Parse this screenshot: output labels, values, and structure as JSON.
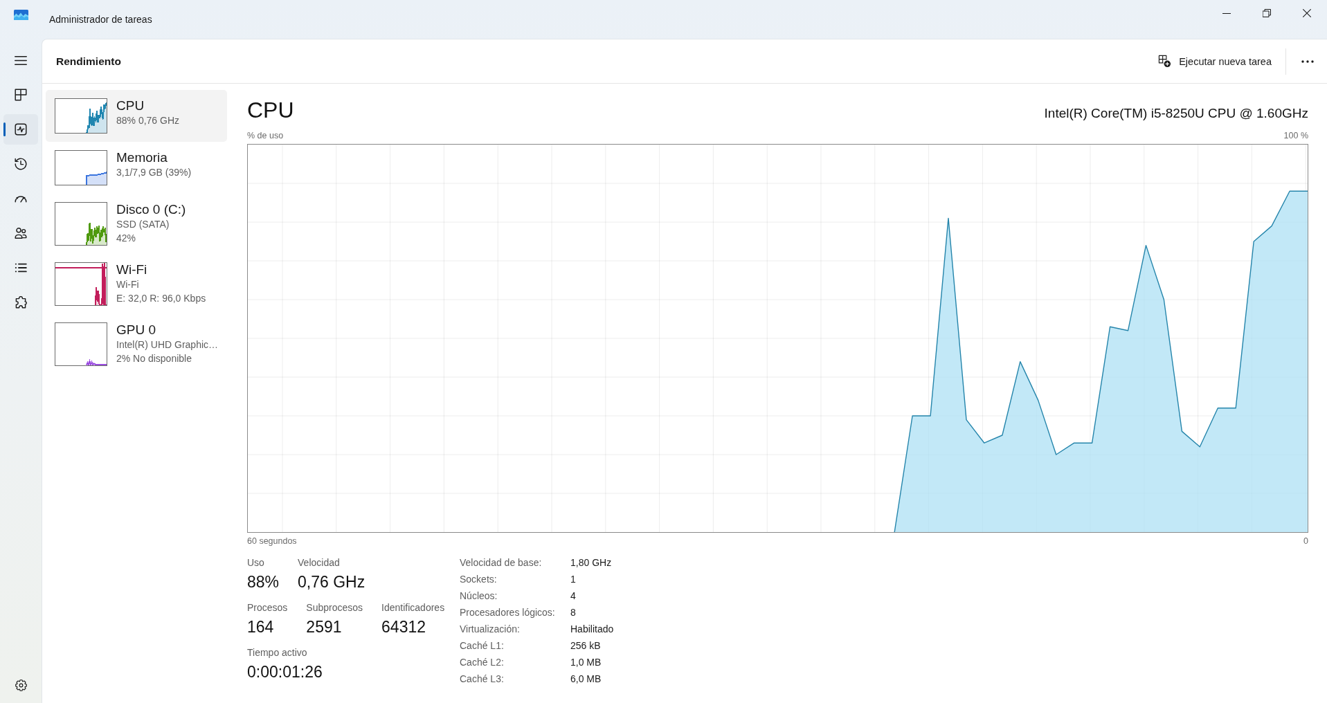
{
  "window": {
    "title": "Administrador de tareas"
  },
  "nav": {
    "items": [
      {
        "kind": "processes",
        "selected": false
      },
      {
        "kind": "performance",
        "selected": true
      },
      {
        "kind": "history",
        "selected": false
      },
      {
        "kind": "startup",
        "selected": false
      },
      {
        "kind": "users",
        "selected": false
      },
      {
        "kind": "details",
        "selected": false
      },
      {
        "kind": "services",
        "selected": false
      }
    ]
  },
  "header": {
    "title": "Rendimiento",
    "action": "Ejecutar nueva tarea"
  },
  "devices": [
    {
      "kind": "cpu",
      "name": "CPU",
      "lines": [
        "88% 0,76 GHz"
      ],
      "color": "#1f86b0",
      "selected": true
    },
    {
      "kind": "memory",
      "name": "Memoria",
      "lines": [
        "3,1/7,9 GB (39%)"
      ],
      "color": "#3a74de",
      "selected": false
    },
    {
      "kind": "disk",
      "name": "Disco 0 (C:)",
      "lines": [
        "SSD (SATA)",
        "42%"
      ],
      "color": "#4f9a0e",
      "selected": false
    },
    {
      "kind": "network",
      "name": "Wi-Fi",
      "lines": [
        "Wi-Fi",
        "E: 32,0 R: 96,0 Kbps"
      ],
      "color": "#c21e5b",
      "selected": false
    },
    {
      "kind": "gpu",
      "name": "GPU 0",
      "lines": [
        "Intel(R) UHD Graphic…",
        "2% No disponible"
      ],
      "color": "#9b4de0",
      "selected": false
    }
  ],
  "detail": {
    "title": "CPU",
    "subtitle": "Intel(R) Core(TM) i5-8250U CPU @ 1.60GHz",
    "graph": {
      "y_label": "% de uso",
      "y_max_label": "100 %",
      "x_start_label": "60 segundos",
      "x_end_label": "0"
    },
    "stats": [
      {
        "items": [
          {
            "label": "Uso",
            "value": "88%"
          },
          {
            "label": "Velocidad",
            "value": "0,76 GHz"
          }
        ]
      },
      {
        "items": [
          {
            "label": "Procesos",
            "value": "164"
          },
          {
            "label": "Subprocesos",
            "value": "2591"
          },
          {
            "label": "Identificadores",
            "value": "64312"
          }
        ]
      },
      {
        "items": [
          {
            "label": "Tiempo activo",
            "value": "0:00:01:26"
          }
        ]
      }
    ],
    "specs": [
      {
        "label": "Velocidad de base:",
        "value": "1,80 GHz"
      },
      {
        "label": "Sockets:",
        "value": "1"
      },
      {
        "label": "Núcleos:",
        "value": "4"
      },
      {
        "label": "Procesadores lógicos:",
        "value": "8"
      },
      {
        "label": "Virtualización:",
        "value": "Habilitado"
      },
      {
        "label": "Caché L1:",
        "value": "256 kB"
      },
      {
        "label": "Caché L2:",
        "value": "1,0 MB"
      },
      {
        "label": "Caché L3:",
        "value": "6,0 MB"
      }
    ]
  }
}
